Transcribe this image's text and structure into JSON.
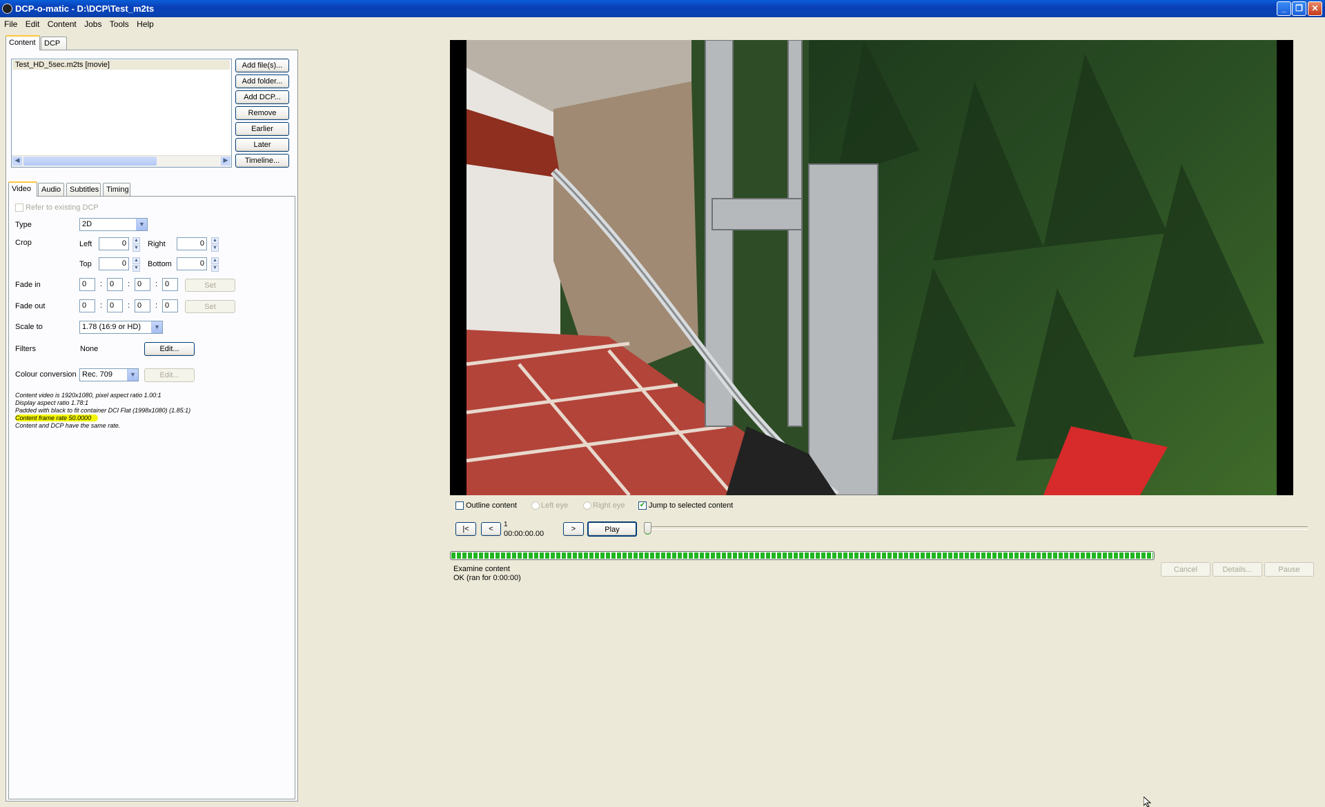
{
  "window": {
    "title": "DCP-o-matic - D:\\DCP\\Test_m2ts"
  },
  "menu": [
    "File",
    "Edit",
    "Content",
    "Jobs",
    "Tools",
    "Help"
  ],
  "main_tabs": {
    "content": "Content",
    "dcp": "DCP"
  },
  "content_list": {
    "items": [
      "Test_HD_5sec.m2ts [movie]"
    ]
  },
  "content_buttons": {
    "add_files": "Add file(s)...",
    "add_folder": "Add folder...",
    "add_dcp": "Add DCP...",
    "remove": "Remove",
    "earlier": "Earlier",
    "later": "Later",
    "timeline": "Timeline..."
  },
  "sub_tabs": {
    "video": "Video",
    "audio": "Audio",
    "subtitles": "Subtitles",
    "timing": "Timing"
  },
  "video_panel": {
    "refer_label": "Refer to existing DCP",
    "type_label": "Type",
    "type_value": "2D",
    "crop_label": "Crop",
    "left_label": "Left",
    "left_value": "0",
    "right_label": "Right",
    "right_value": "0",
    "top_label": "Top",
    "top_value": "0",
    "bottom_label": "Bottom",
    "bottom_value": "0",
    "fade_in_label": "Fade in",
    "fade_in": [
      "0",
      "0",
      "0",
      "0"
    ],
    "fade_out_label": "Fade out",
    "fade_out": [
      "0",
      "0",
      "0",
      "0"
    ],
    "separator": ":",
    "set_label": "Set",
    "scale_label": "Scale to",
    "scale_value": "1.78 (16:9 or HD)",
    "filters_label": "Filters",
    "filters_value": "None",
    "edit_label": "Edit...",
    "colour_label": "Colour conversion",
    "colour_value": "Rec. 709",
    "info": [
      "Content video is 1920x1080, pixel aspect ratio 1.00:1",
      "Display aspect ratio 1.78:1",
      "Padded with black to fit container DCI Flat (1998x1080) (1.85:1)",
      "Content frame rate 50.0000",
      "Content and DCP have the same rate."
    ]
  },
  "viewer": {
    "outline_label": "Outline content",
    "left_eye_label": "Left eye",
    "right_eye_label": "Right eye",
    "jump_label": "Jump to selected content",
    "jump_checked": true,
    "btn_start": "|<",
    "btn_back": "<",
    "frame_number": "1",
    "timecode": "00:00:00.00",
    "btn_forward": ">",
    "btn_play": "Play"
  },
  "job": {
    "progress": 1.0,
    "name": "Examine content",
    "status": "OK (ran for 0:00:00)",
    "cancel": "Cancel",
    "details": "Details...",
    "pause": "Pause"
  },
  "colors": {
    "accent": "#0a3fb8",
    "highlight": "#f4f700",
    "progress": "#21b521"
  }
}
